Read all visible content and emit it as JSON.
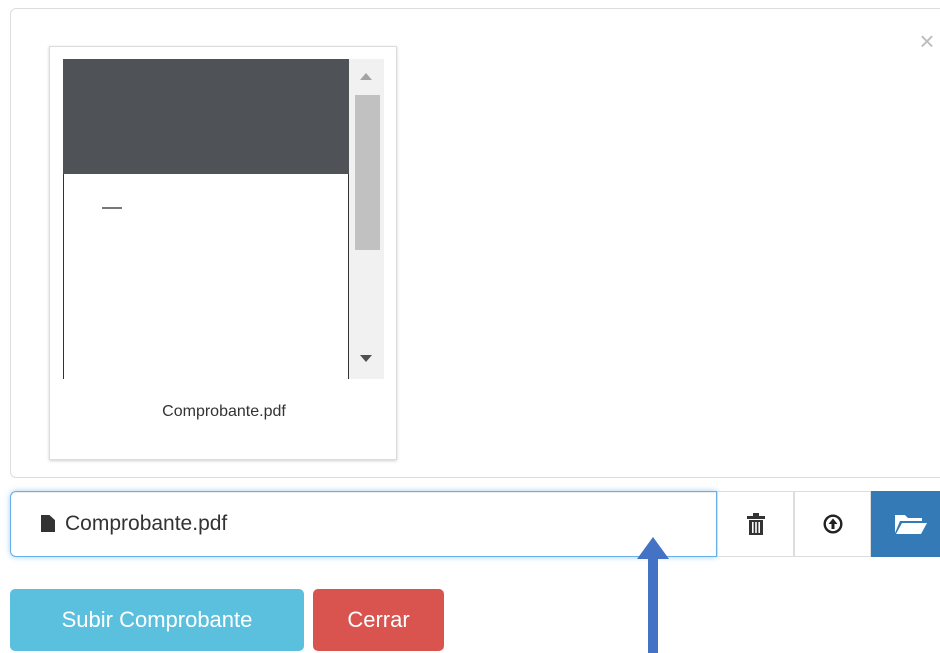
{
  "preview": {
    "close_glyph": "×",
    "file_caption": "Comprobante.pdf"
  },
  "file_input": {
    "file_name": "Comprobante.pdf",
    "icons": [
      "file-icon",
      "trash-icon",
      "upload-icon",
      "folder-open-icon"
    ]
  },
  "actions": {
    "submit_label": "Subir Comprobante",
    "close_label": "Cerrar"
  },
  "colors": {
    "focus_border": "#66afe9",
    "browse_button": "#337ab7",
    "submit_button": "#5bc0de",
    "close_button": "#d9534f",
    "annotation_arrow": "#4472c4"
  }
}
